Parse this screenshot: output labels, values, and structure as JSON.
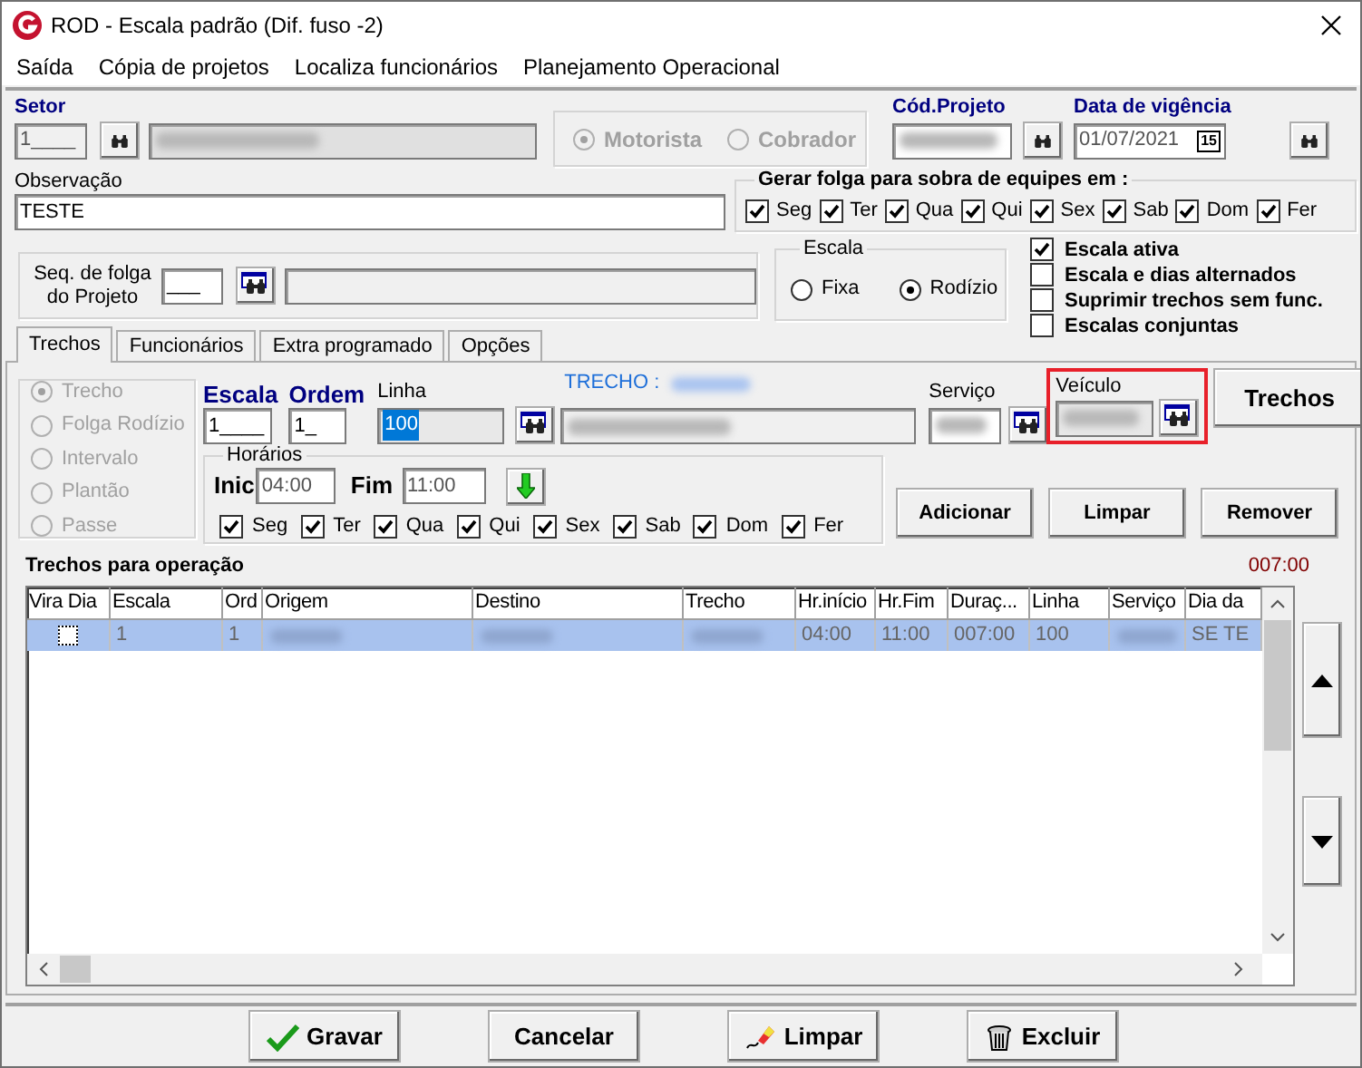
{
  "window": {
    "title": "ROD - Escala padrão (Dif. fuso -2)"
  },
  "menu": [
    "Saída",
    "Cópia de projetos",
    "Localiza funcionários",
    "Planejamento Operacional"
  ],
  "header": {
    "setor": {
      "label": "Setor",
      "value": "1____",
      "name_redacted": true
    },
    "funcao": {
      "disabled": true,
      "options": [
        {
          "label": "Motorista",
          "selected": true
        },
        {
          "label": "Cobrador",
          "selected": false
        }
      ]
    },
    "cod_projeto": {
      "label": "Cód.Projeto",
      "redacted": true
    },
    "data_vigencia": {
      "label": "Data de vigência",
      "value": "01/07/2021",
      "calendar": "15"
    }
  },
  "observacao": {
    "label": "Observação",
    "value": "TESTE"
  },
  "gerar_folga": {
    "title": "Gerar folga para sobra de equipes em :",
    "days": [
      {
        "label": "Seg",
        "checked": true
      },
      {
        "label": "Ter",
        "checked": true
      },
      {
        "label": "Qua",
        "checked": true
      },
      {
        "label": "Qui",
        "checked": true
      },
      {
        "label": "Sex",
        "checked": true
      },
      {
        "label": "Sab",
        "checked": true
      },
      {
        "label": "Dom",
        "checked": true
      },
      {
        "label": "Fer",
        "checked": true
      }
    ]
  },
  "seq_folga": {
    "label": "Seq. de folga do Projeto",
    "value": "___"
  },
  "escala": {
    "title": "Escala",
    "options": [
      {
        "label": "Fixa",
        "selected": false
      },
      {
        "label": "Rodízio",
        "selected": true
      }
    ]
  },
  "flags": [
    {
      "label": "Escala ativa",
      "checked": true
    },
    {
      "label": "Escala e dias alternados",
      "checked": false
    },
    {
      "label": "Suprimir trechos sem func.",
      "checked": false
    },
    {
      "label": "Escalas conjuntas",
      "checked": false
    }
  ],
  "tabs": [
    {
      "label": "Trechos",
      "selected": true
    },
    {
      "label": "Funcionários",
      "selected": false
    },
    {
      "label": "Extra programado",
      "selected": false
    },
    {
      "label": "Opções",
      "selected": false
    }
  ],
  "trecho_panel": {
    "tipos": {
      "disabled": true,
      "options": [
        {
          "label": "Trecho",
          "selected": true
        },
        {
          "label": "Folga Rodízio",
          "selected": false
        },
        {
          "label": "Intervalo",
          "selected": false
        },
        {
          "label": "Plantão",
          "selected": false
        },
        {
          "label": "Passe",
          "selected": false
        }
      ]
    },
    "escala": {
      "label": "Escala",
      "value": "1____"
    },
    "ordem": {
      "label": "Ordem",
      "value": "1_"
    },
    "linha": {
      "label": "Linha",
      "value": "100",
      "selected": true
    },
    "trecho": {
      "label": "TRECHO :"
    },
    "servico": {
      "label": "Serviço"
    },
    "veiculo": {
      "label": "Veículo",
      "highlighted": true
    },
    "trechos_button": {
      "label": "Trechos"
    },
    "horarios": {
      "title": "Horários",
      "inic": {
        "label": "Inic",
        "value": "04:00"
      },
      "fim": {
        "label": "Fim",
        "value": "11:00"
      },
      "days": [
        {
          "label": "Seg",
          "checked": true
        },
        {
          "label": "Ter",
          "checked": true
        },
        {
          "label": "Qua",
          "checked": true
        },
        {
          "label": "Qui",
          "checked": true
        },
        {
          "label": "Sex",
          "checked": true
        },
        {
          "label": "Sab",
          "checked": true
        },
        {
          "label": "Dom",
          "checked": true
        },
        {
          "label": "Fer",
          "checked": true
        }
      ]
    },
    "buttons": [
      "Adicionar",
      "Limpar",
      "Remover"
    ]
  },
  "grid": {
    "title": "Trechos para operação",
    "total": "007:00",
    "columns": [
      "Vira Dia",
      "Escala",
      "Ord",
      "Origem",
      "Destino",
      "Trecho",
      "Hr.início",
      "Hr.Fim",
      "Duraç...",
      "Linha",
      "Serviço",
      "Dia da"
    ],
    "rows": [
      {
        "selected": true,
        "cells": [
          {
            "kind": "checkbox",
            "checked": false
          },
          {
            "text": "1"
          },
          {
            "text": "1"
          },
          {
            "kind": "blurred"
          },
          {
            "kind": "blurred"
          },
          {
            "kind": "blurred"
          },
          {
            "text": "04:00"
          },
          {
            "text": "11:00"
          },
          {
            "text": "007:00"
          },
          {
            "text": "100"
          },
          {
            "kind": "blurred"
          },
          {
            "text": "SE TE"
          }
        ]
      }
    ]
  },
  "footer_buttons": [
    {
      "label": "Gravar",
      "kind": "save"
    },
    {
      "label": "Cancelar",
      "kind": "cancel"
    },
    {
      "label": "Limpar",
      "kind": "clear"
    },
    {
      "label": "Excluir",
      "kind": "delete"
    }
  ]
}
